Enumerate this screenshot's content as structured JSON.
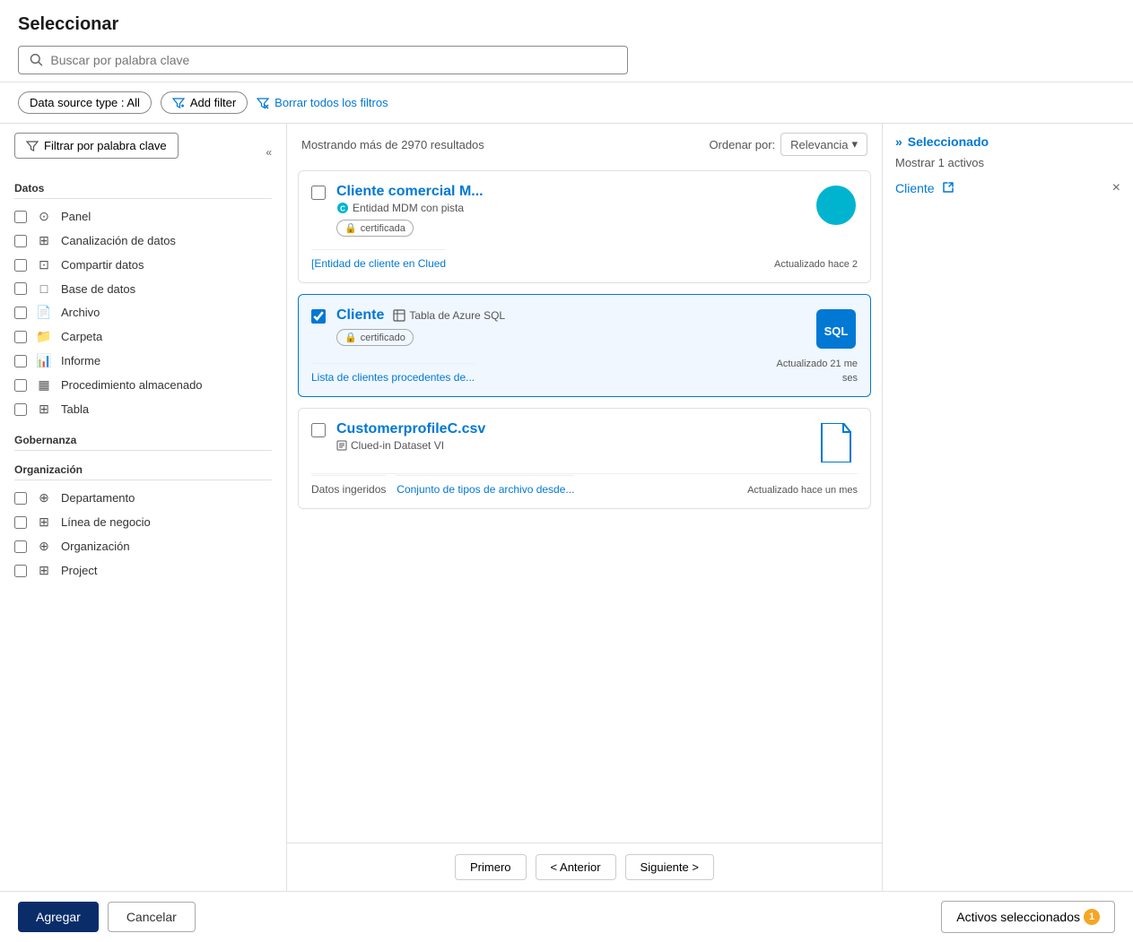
{
  "page": {
    "title": "Seleccionar"
  },
  "search": {
    "placeholder": "Buscar por palabra clave"
  },
  "filters": {
    "datasource_type_label": "Data source type : All",
    "add_filter_label": "Add filter",
    "clear_filters_label": "Borrar todos los filtros",
    "keyword_filter_label": "Filtrar por palabra clave"
  },
  "results": {
    "summary": "Mostrando más de 2970 resultados",
    "sort_label": "Ordenar por:",
    "sort_value": "Relevancia",
    "cards": [
      {
        "id": 1,
        "title": "Cliente comercial M...",
        "subtitle": "Entidad MDM con pista",
        "badge": "certificada",
        "description": "[Entidad de cliente en Clued",
        "meta": "Actualizado hace 2",
        "selected": false,
        "type": "mdm"
      },
      {
        "id": 2,
        "title": "Cliente",
        "subtitle": "Tabla de Azure SQL",
        "badge": "certificado",
        "description": "Lista de clientes procedentes de...",
        "meta": "Actualizado 21 me",
        "meta2": "ses",
        "selected": true,
        "type": "sql"
      },
      {
        "id": 3,
        "title": "CustomerprofileC.csv",
        "subtitle": "Clued-in Dataset VI",
        "badge": null,
        "description_prefix": "Datos ingeridos",
        "description": "Conjunto de tipos de archivo desde...",
        "meta": "Actualizado hace un mes",
        "selected": false,
        "type": "file"
      }
    ]
  },
  "pagination": {
    "first_label": "Primero",
    "prev_label": "< Anterior",
    "next_label": "Siguiente >"
  },
  "sidebar": {
    "sections": [
      {
        "name": "Datos",
        "items": [
          {
            "label": "Panel",
            "icon": "⊙"
          },
          {
            "label": "Canalización de datos",
            "icon": "⊞"
          },
          {
            "label": "Compartir datos",
            "icon": "⊡"
          },
          {
            "label": "Base de datos",
            "icon": "□"
          },
          {
            "label": "Archivo",
            "icon": "📄"
          },
          {
            "label": "Carpeta",
            "icon": "📁"
          },
          {
            "label": "Informe",
            "icon": "📊"
          },
          {
            "label": "Procedimiento almacenado",
            "icon": "▦"
          },
          {
            "label": "Tabla",
            "icon": "⊞"
          }
        ]
      },
      {
        "name": "Gobernanza",
        "items": []
      },
      {
        "name": "Organización",
        "items": [
          {
            "label": "Departamento",
            "icon": "⊕"
          },
          {
            "label": "Línea de negocio",
            "icon": "⊞"
          },
          {
            "label": "Organización",
            "icon": "⊕"
          },
          {
            "label": "Project",
            "icon": "⊞"
          }
        ]
      }
    ]
  },
  "right_panel": {
    "header": "Seleccionado",
    "active_count": "Mostrar 1 activos",
    "selected_item": "Cliente",
    "chevron": "»"
  },
  "bottom_bar": {
    "add_label": "Agregar",
    "cancel_label": "Cancelar",
    "activos_label": "Activos seleccionados",
    "activos_count": "1"
  }
}
